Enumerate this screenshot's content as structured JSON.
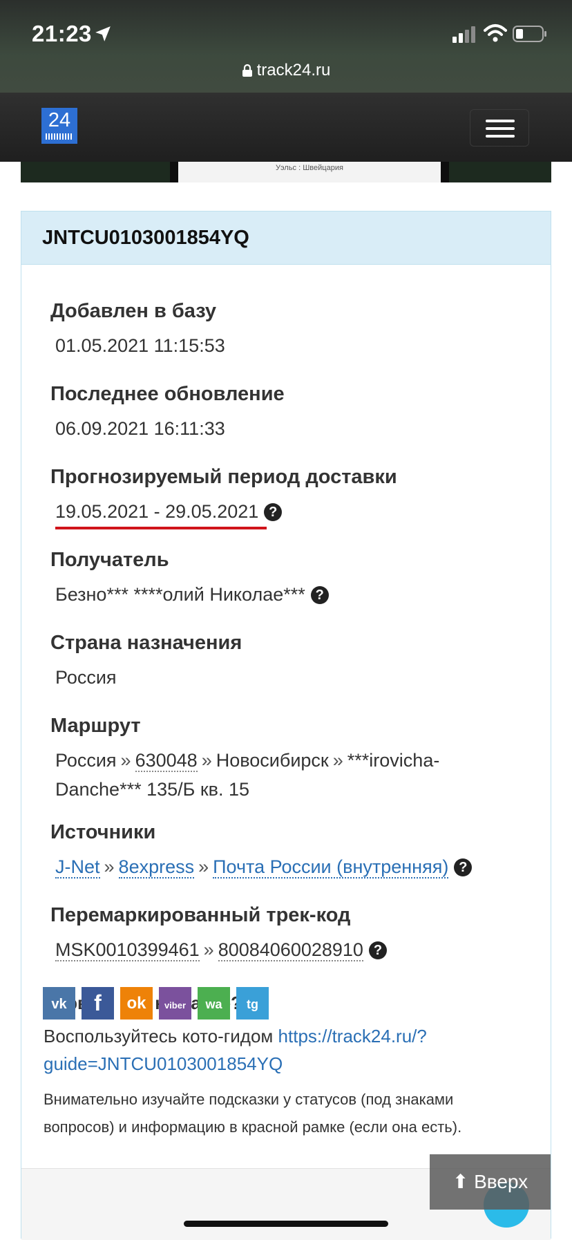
{
  "status_bar": {
    "time": "21:23",
    "url": "track24.ru"
  },
  "navbar": {
    "logo_text": "24"
  },
  "banner": {
    "caption": "Уэльс : Швейцария"
  },
  "tracking": {
    "code": "JNTCU0103001854YQ",
    "added": {
      "label": "Добавлен в базу",
      "value": "01.05.2021 11:15:53"
    },
    "updated": {
      "label": "Последнее обновление",
      "value": "06.09.2021 16:11:33"
    },
    "delivery_period": {
      "label": "Прогнозируемый период доставки",
      "value": "19.05.2021 - 29.05.2021"
    },
    "recipient": {
      "label": "Получатель",
      "value": "Безно*** ****олий Николае***"
    },
    "country": {
      "label": "Страна назначения",
      "value": "Россия"
    },
    "route": {
      "label": "Маршрут",
      "parts": [
        "Россия",
        "630048",
        "Новосибирск",
        "***irovicha-Danche*** 135/Б кв. 15"
      ],
      "separator": "»"
    },
    "sources": {
      "label": "Источники",
      "items": [
        "J-Net",
        "8express",
        "Почта России (внутренняя)"
      ]
    },
    "remarked": {
      "label": "Перемаркированный трек-код",
      "items": [
        "MSK0010399461",
        "80084060028910"
      ]
    }
  },
  "guide": {
    "title": "Первый раз на сайте?",
    "text": "Воспользуйтесь кото-гидом",
    "link_line1": "https://track24.ru/?",
    "link_line2": "guide=JNTCU0103001854YQ",
    "note": "Внимательно изучайте подсказки у статусов (под знаками вопросов) и информацию в красной рамке (если она есть)."
  },
  "social": [
    {
      "icon": "vk-icon",
      "color": "#4a76a8",
      "label": "vk"
    },
    {
      "icon": "facebook-icon",
      "color": "#3b5998",
      "label": "f"
    },
    {
      "icon": "odnoklassniki-icon",
      "color": "#ee8208",
      "label": "ok"
    },
    {
      "icon": "viber-icon",
      "color": "#7b519d",
      "label": "viber"
    },
    {
      "icon": "whatsapp-icon",
      "color": "#4caf50",
      "label": "wa"
    },
    {
      "icon": "telegram-icon",
      "color": "#3aa0d8",
      "label": "tg"
    }
  ],
  "scroll_up": {
    "label": "Вверх"
  },
  "help_glyph": "?"
}
